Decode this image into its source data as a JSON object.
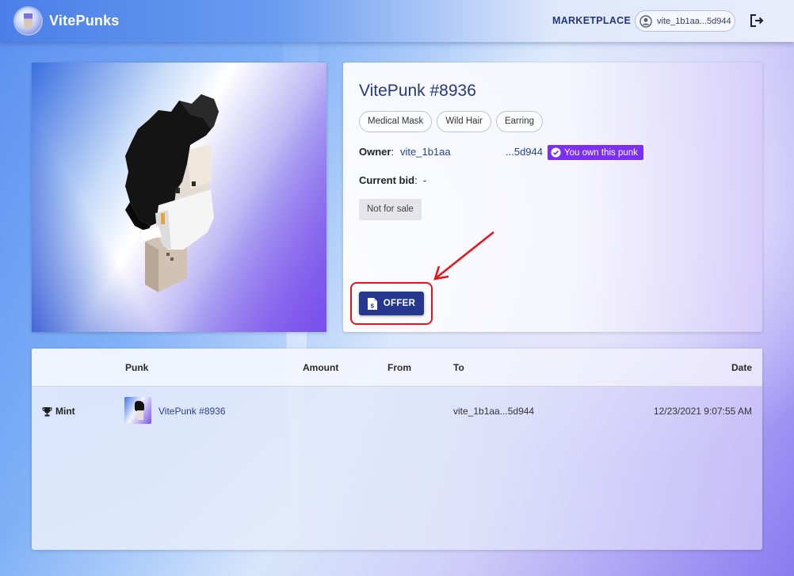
{
  "header": {
    "brand": "VitePunks",
    "nav_marketplace": "MARKETPLACE",
    "wallet_address": "vite_1b1aa...5d944"
  },
  "punk": {
    "title": "VitePunk #8936",
    "traits": [
      "Medical Mask",
      "Wild Hair",
      "Earring"
    ],
    "owner_label": "Owner",
    "owner_address_start": "vite_1b1aa",
    "owner_address_end": "...5d944",
    "own_badge": "You own this punk",
    "current_bid_label": "Current bid",
    "current_bid_value": "-",
    "sale_status": "Not for sale",
    "offer_label": "OFFER"
  },
  "history": {
    "columns": [
      "Punk",
      "Amount",
      "From",
      "To",
      "Date"
    ],
    "rows": [
      {
        "event": "Mint",
        "punk": "VitePunk #8936",
        "amount": "",
        "from": "",
        "to": "vite_1b1aa...5d944",
        "date": "12/23/2021 9:07:55 AM"
      }
    ]
  },
  "colors": {
    "brand_navy": "#25388e",
    "badge_purple": "#7b2ff2",
    "annotation_red": "#e3141a"
  }
}
